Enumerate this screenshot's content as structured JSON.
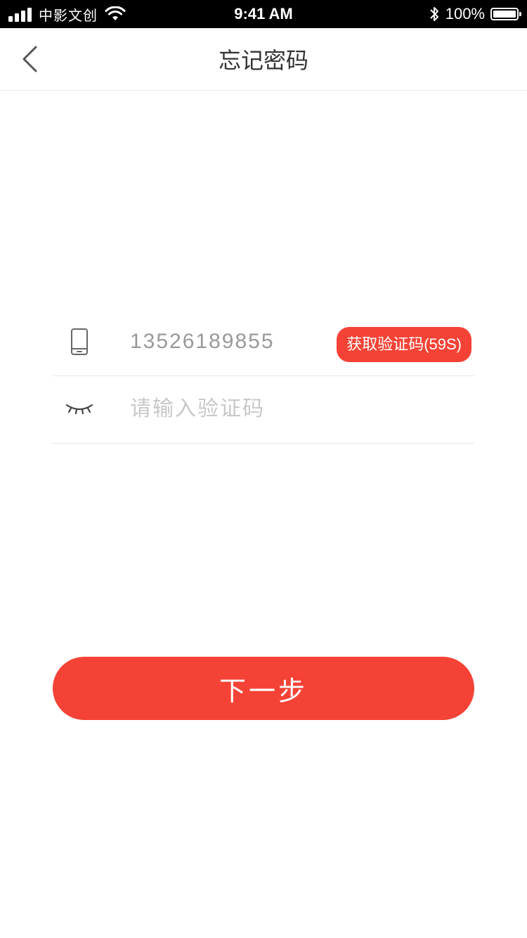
{
  "status_bar": {
    "carrier": "中影文创",
    "time": "9:41 AM",
    "battery_percent": "100%",
    "signal_bars": 4,
    "battery_level": 1.0
  },
  "nav": {
    "title": "忘记密码",
    "back_icon": "chevron-left-icon"
  },
  "form": {
    "phone": {
      "icon": "mobile-phone-icon",
      "value": "13526189855",
      "code_button_label": "获取验证码(59S)"
    },
    "code": {
      "icon": "closed-eye-icon",
      "placeholder": "请输入验证码",
      "value": ""
    }
  },
  "next_button_label": "下一步",
  "colors": {
    "accent": "#f44336",
    "status_bar_bg": "#000000",
    "divider": "#e6e6e6",
    "input_text": "#999999",
    "placeholder": "#c8c8c8"
  }
}
